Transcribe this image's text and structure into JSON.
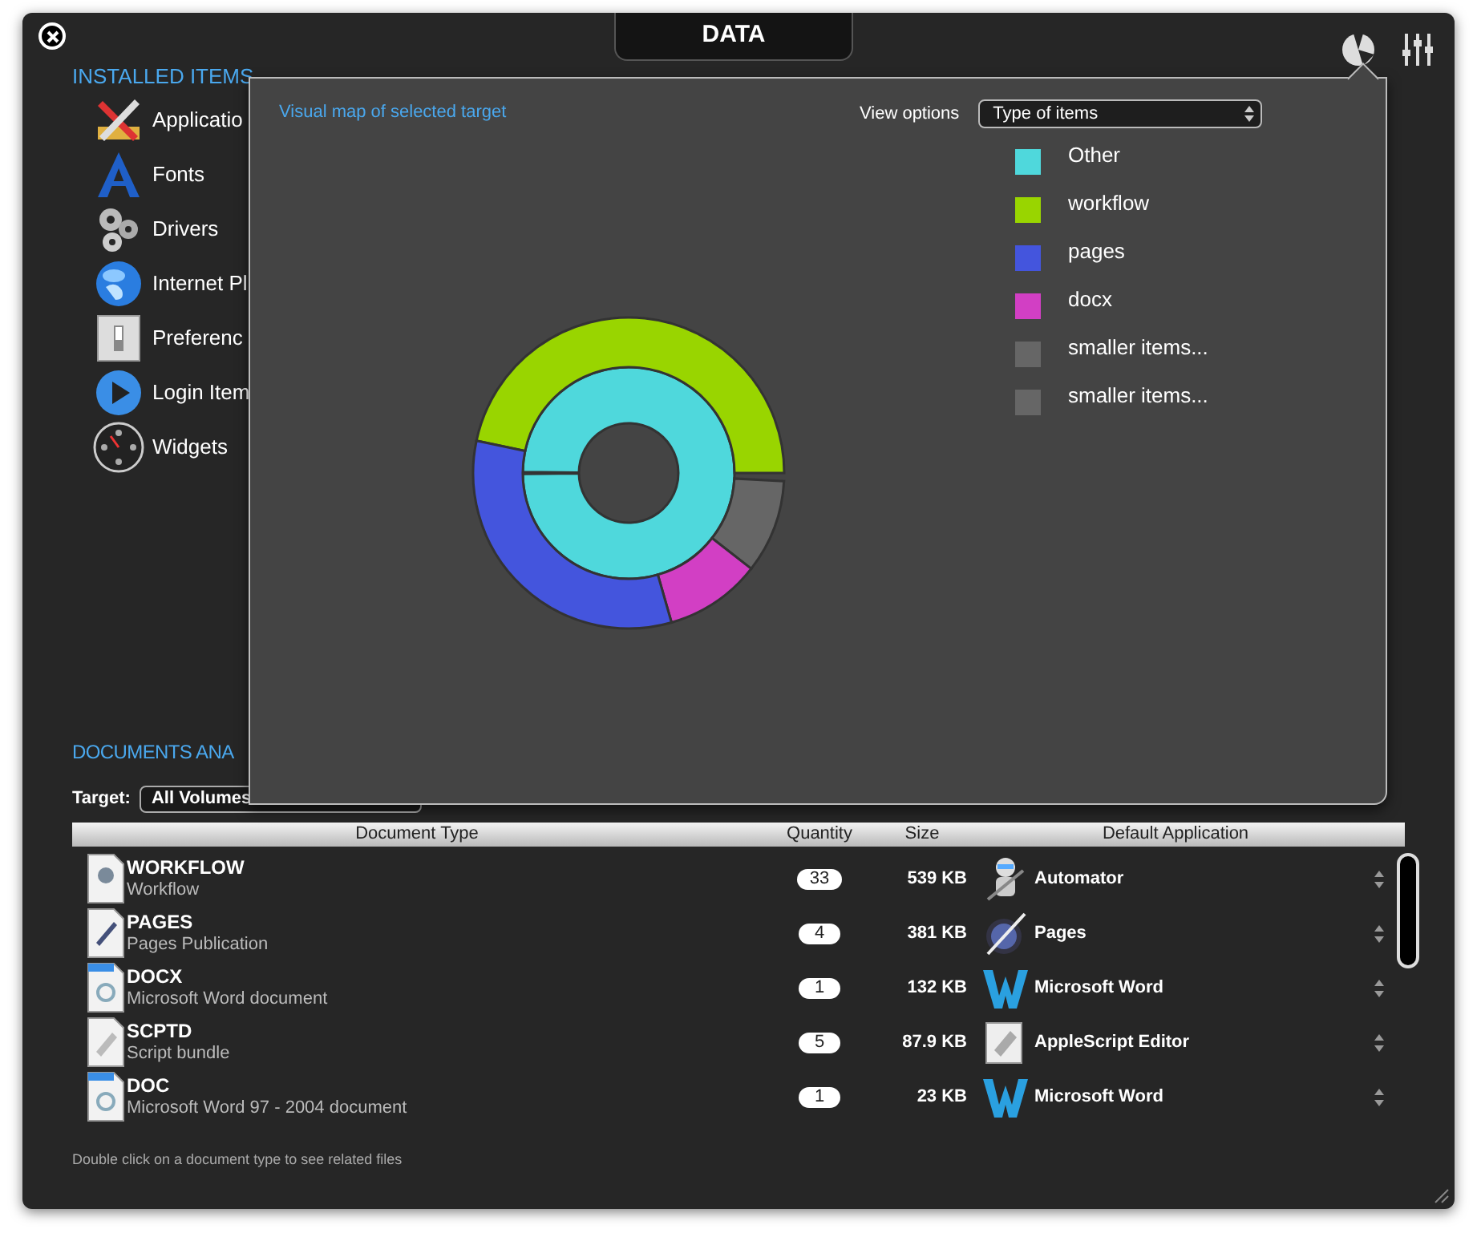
{
  "window": {
    "tab": "DATA"
  },
  "sidebar": {
    "title": "INSTALLED ITEMS",
    "items": [
      "Applicatio",
      "Fonts",
      "Drivers",
      "Internet Pl",
      "Preferenc",
      "Login Item",
      "Widgets"
    ]
  },
  "documents": {
    "title": "DOCUMENTS ANA",
    "target_label": "Target:",
    "target_value": "All Volumes"
  },
  "table": {
    "columns": [
      "Document Type",
      "Quantity",
      "Size",
      "Default Application"
    ],
    "rows": [
      {
        "type": "WORKFLOW",
        "description": "Workflow",
        "quantity": "33",
        "size": "539 KB",
        "application": "Automator"
      },
      {
        "type": "PAGES",
        "description": "Pages Publication",
        "quantity": "4",
        "size": "381 KB",
        "application": "Pages"
      },
      {
        "type": "DOCX",
        "description": "Microsoft Word document",
        "quantity": "1",
        "size": "132 KB",
        "application": "Microsoft Word"
      },
      {
        "type": "SCPTD",
        "description": "Script bundle",
        "quantity": "5",
        "size": "87.9 KB",
        "application": "AppleScript Editor"
      },
      {
        "type": "DOC",
        "description": "Microsoft Word 97 - 2004 document",
        "quantity": "1",
        "size": "23 KB",
        "application": "Microsoft Word"
      }
    ]
  },
  "footer": "Double click on a document type to see related files",
  "popover": {
    "title": "Visual map of selected target",
    "view_options_label": "View options",
    "view_options_value": "Type of items",
    "legend": [
      {
        "label": "Other",
        "color": "#4fd8dc"
      },
      {
        "label": "workflow",
        "color": "#99d500"
      },
      {
        "label": "pages",
        "color": "#4455dd"
      },
      {
        "label": "docx",
        "color": "#d23fc4"
      },
      {
        "label": "smaller items...",
        "color": "#666666"
      },
      {
        "label": "smaller items...",
        "color": "#666666"
      }
    ]
  }
}
